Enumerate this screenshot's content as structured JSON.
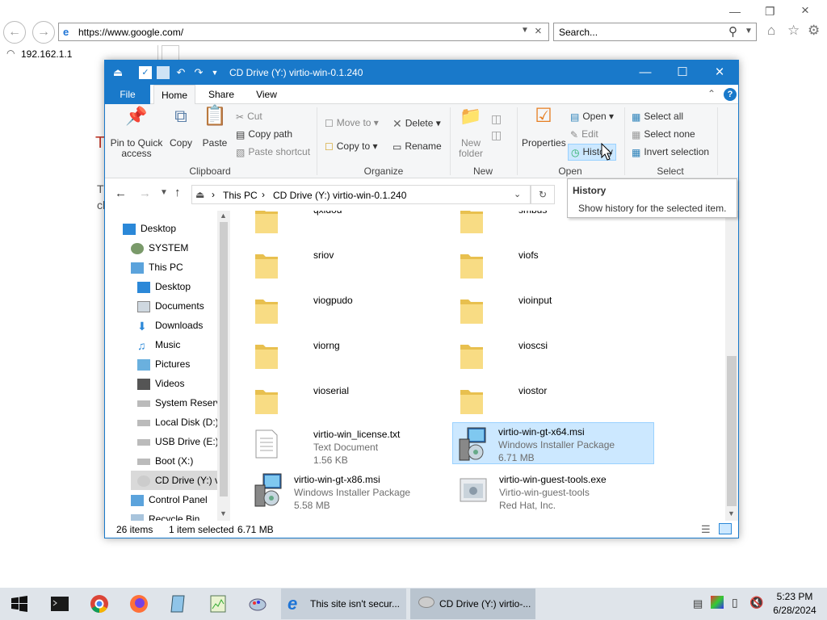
{
  "browser": {
    "url": "https://www.google.com/",
    "search_placeholder": "Search...",
    "tab_title": "192.162.1.1",
    "bg_fragment_1": "T",
    "bg_fragment_2": "cl",
    "bg_fragment_3": "T"
  },
  "window": {
    "title": "CD Drive (Y:) virtio-win-0.1.240",
    "tabs": [
      "File",
      "Home",
      "Share",
      "View"
    ]
  },
  "ribbon": {
    "clipboard": {
      "pin": "Pin to Quick access",
      "copy": "Copy",
      "paste": "Paste",
      "cut": "Cut",
      "copy_path": "Copy path",
      "paste_shortcut": "Paste shortcut",
      "label": "Clipboard"
    },
    "organize": {
      "move_to": "Move to",
      "copy_to": "Copy to",
      "delete": "Delete",
      "rename": "Rename",
      "label": "Organize"
    },
    "new": {
      "new_folder": "New folder",
      "label": "New"
    },
    "open": {
      "properties": "Properties",
      "open": "Open",
      "edit": "Edit",
      "history": "History",
      "label": "Open"
    },
    "select": {
      "select_all": "Select all",
      "select_none": "Select none",
      "invert": "Invert selection",
      "label": "Select"
    }
  },
  "breadcrumb": {
    "root": "This PC",
    "current": "CD Drive (Y:) virtio-win-0.1.240"
  },
  "tooltip": {
    "title": "History",
    "body": "Show history for the selected item."
  },
  "tree": [
    "Desktop",
    "SYSTEM",
    "This PC",
    "Desktop",
    "Documents",
    "Downloads",
    "Music",
    "Pictures",
    "Videos",
    "System Reserve",
    "Local Disk (D:)",
    "USB Drive (E:)",
    "Boot (X:)",
    "CD Drive (Y:) vi",
    "Control Panel",
    "Recycle Bin"
  ],
  "files": [
    {
      "name": "qxldod",
      "type": "folder"
    },
    {
      "name": "smbus",
      "type": "folder"
    },
    {
      "name": "sriov",
      "type": "folder"
    },
    {
      "name": "viofs",
      "type": "folder"
    },
    {
      "name": "viogpudo",
      "type": "folder"
    },
    {
      "name": "vioinput",
      "type": "folder"
    },
    {
      "name": "viorng",
      "type": "folder"
    },
    {
      "name": "vioscsi",
      "type": "folder"
    },
    {
      "name": "vioserial",
      "type": "folder"
    },
    {
      "name": "viostor",
      "type": "folder"
    },
    {
      "name": "virtio-win_license.txt",
      "kind": "Text Document",
      "size": "1.56 KB"
    },
    {
      "name": "virtio-win-gt-x64.msi",
      "kind": "Windows Installer Package",
      "size": "6.71 MB",
      "selected": true
    },
    {
      "name": "virtio-win-gt-x86.msi",
      "kind": "Windows Installer Package",
      "size": "5.58 MB"
    },
    {
      "name": "virtio-win-guest-tools.exe",
      "kind": "Virtio-win-guest-tools",
      "size": "Red Hat, Inc."
    }
  ],
  "status": {
    "count": "26 items",
    "selected": "1 item selected",
    "size": "6.71 MB"
  },
  "taskbar": {
    "task_ie": "This site isn't secur...",
    "task_explorer": "CD Drive (Y:) virtio-...",
    "time": "5:23 PM",
    "date": "6/28/2024"
  },
  "colors": {
    "accent": "#1979ca",
    "selection": "#cce8ff",
    "folder": "#f5d77a"
  }
}
